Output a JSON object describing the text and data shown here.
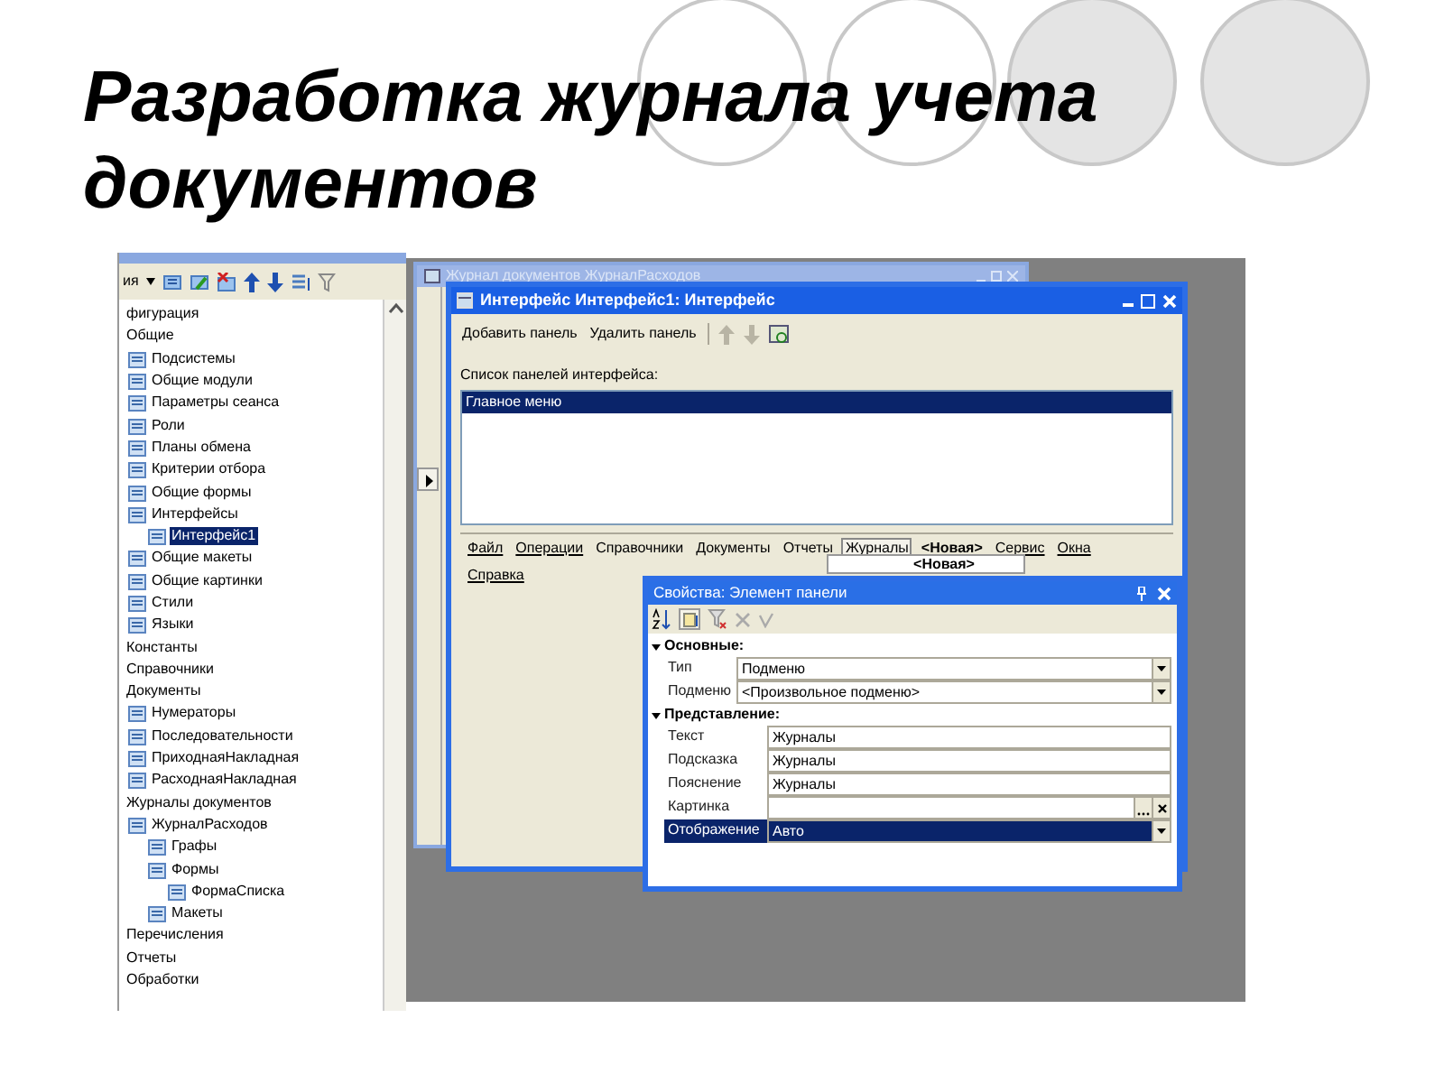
{
  "slide": {
    "title": "Разработка журнала учета документов"
  },
  "tree_panel": {
    "toolbar_label": "ия",
    "items": [
      {
        "label": "фигурация",
        "selected": false
      },
      {
        "label": "Общие",
        "selected": false,
        "children": [
          {
            "label": "Подсистемы",
            "selected": false
          },
          {
            "label": "Общие модули",
            "selected": false
          },
          {
            "label": "Параметры сеанса",
            "selected": false
          },
          {
            "label": "Роли",
            "selected": false
          },
          {
            "label": "Планы обмена",
            "selected": false
          },
          {
            "label": "Критерии отбора",
            "selected": false
          },
          {
            "label": "Общие формы",
            "selected": false
          },
          {
            "label": "Интерфейсы",
            "selected": false,
            "children": [
              {
                "label": "Интерфейс1",
                "selected": true
              }
            ]
          },
          {
            "label": "Общие макеты",
            "selected": false
          },
          {
            "label": "Общие картинки",
            "selected": false
          },
          {
            "label": "Стили",
            "selected": false
          },
          {
            "label": "Языки",
            "selected": false
          }
        ]
      },
      {
        "label": "Константы",
        "selected": false
      },
      {
        "label": "Справочники",
        "selected": false
      },
      {
        "label": "Документы",
        "selected": false,
        "children": [
          {
            "label": "Нумераторы",
            "selected": false
          },
          {
            "label": "Последовательности",
            "selected": false
          },
          {
            "label": "ПриходнаяНакладная",
            "selected": false
          },
          {
            "label": "РасходнаяНакладная",
            "selected": false
          }
        ]
      },
      {
        "label": "Журналы документов",
        "selected": false,
        "children": [
          {
            "label": "ЖурналРасходов",
            "selected": false,
            "children": [
              {
                "label": "Графы",
                "selected": false
              },
              {
                "label": "Формы",
                "selected": false,
                "children": [
                  {
                    "label": "ФормаСписка",
                    "selected": false
                  }
                ]
              },
              {
                "label": "Макеты",
                "selected": false
              }
            ]
          }
        ]
      },
      {
        "label": "Перечисления",
        "selected": false
      },
      {
        "label": "Отчеты",
        "selected": false
      },
      {
        "label": "Обработки",
        "selected": false
      }
    ]
  },
  "journal_window": {
    "title": "Журнал документов ЖурналРасходов"
  },
  "interface_window": {
    "title": "Интерфейс Интерфейс1: Интерфейс",
    "toolbar": [
      "Добавить панель",
      "Удалить панель"
    ],
    "list_label": "Список панелей интерфейса:",
    "panels": [
      {
        "label": "Главное меню",
        "selected": true
      }
    ],
    "menu_items": [
      {
        "label": "Файл",
        "kind": "link",
        "selected": false
      },
      {
        "label": "Операции",
        "kind": "link",
        "selected": false
      },
      {
        "label": "Справочники",
        "kind": "plain",
        "selected": false
      },
      {
        "label": "Документы",
        "kind": "plain",
        "selected": false
      },
      {
        "label": "Отчеты",
        "kind": "plain",
        "selected": false
      },
      {
        "label": "Журналы",
        "kind": "plain",
        "selected": true
      },
      {
        "label": "<Новая>",
        "kind": "bold",
        "selected": false
      },
      {
        "label": "Сервис",
        "kind": "link",
        "selected": false
      },
      {
        "label": "Окна",
        "kind": "link",
        "selected": false
      },
      {
        "label": "Справка",
        "kind": "link",
        "selected": false
      }
    ],
    "popup_item": "<Новая>"
  },
  "properties_window": {
    "title": "Свойства: Элемент панели",
    "groups": [
      {
        "label": "Основные:",
        "expanded": true,
        "rows": [
          {
            "label": "Тип",
            "value": "Подменю",
            "kind": "dropdown",
            "selected": false
          },
          {
            "label": "Подменю",
            "value": "<Произвольное подменю>",
            "kind": "dropdown",
            "selected": false
          }
        ]
      },
      {
        "label": "Представление:",
        "expanded": true,
        "rows": [
          {
            "label": "Текст",
            "value": "Журналы",
            "kind": "text",
            "selected": false
          },
          {
            "label": "Подсказка",
            "value": "Журналы",
            "kind": "text",
            "selected": false
          },
          {
            "label": "Пояснение",
            "value": "Журналы",
            "kind": "text",
            "selected": false
          },
          {
            "label": "Картинка",
            "kind": "picture",
            "selected": false
          },
          {
            "label": "Отображение",
            "value": "Авто",
            "kind": "dropdown",
            "selected": true
          }
        ]
      }
    ]
  }
}
